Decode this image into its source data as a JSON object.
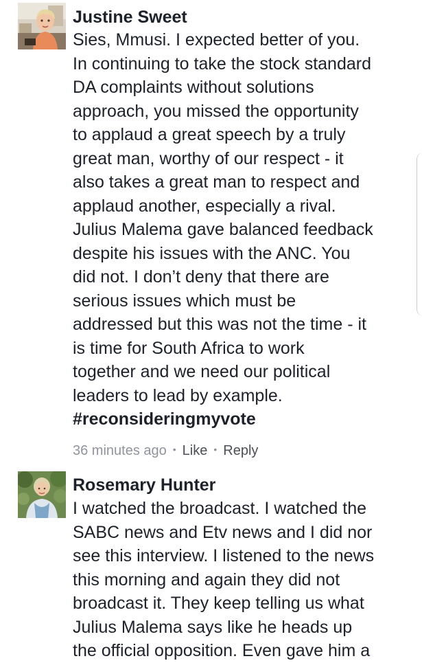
{
  "comments": [
    {
      "author": "Justine Sweet",
      "avatar_icon": "child-photo-avatar",
      "lines": [
        "Sies, Mmusi. I expected better of you.",
        "In continuing to take the stock standard",
        "DA complaints without solutions",
        "approach, you missed the opportunity",
        "to applaud a great speech by a truly",
        "great man, worthy of our respect - it",
        "also takes a great man to respect and",
        "applaud another, especially a rival.",
        "Julius Malema gave balanced feedback",
        "despite his issues with the ANC. You",
        "did not. I don’t deny that there are",
        "serious issues which must be",
        "addressed but this was not the time - it",
        "is time for South Africa to work",
        "together and we need our political",
        "leaders to lead by example."
      ],
      "hashtag": "#reconsideringmyvote",
      "time": "36 minutes ago",
      "separator": "•",
      "like_label": "Like",
      "reply_label": "Reply"
    },
    {
      "author": "Rosemary Hunter",
      "avatar_icon": "woman-photo-avatar",
      "lines": [
        "I watched the broadcast. I watched the",
        "SABC news and Etv news and I did nor",
        "see this interview. I listened to the news",
        "this morning and again they did not",
        "broadcast it. They keep telling us what",
        "Julius Malema says like he heads up",
        "the official opposition. Even gave him a"
      ]
    }
  ],
  "colors": {
    "text": "#1d2129",
    "meta": "#90949c",
    "action": "#4b4f56"
  }
}
